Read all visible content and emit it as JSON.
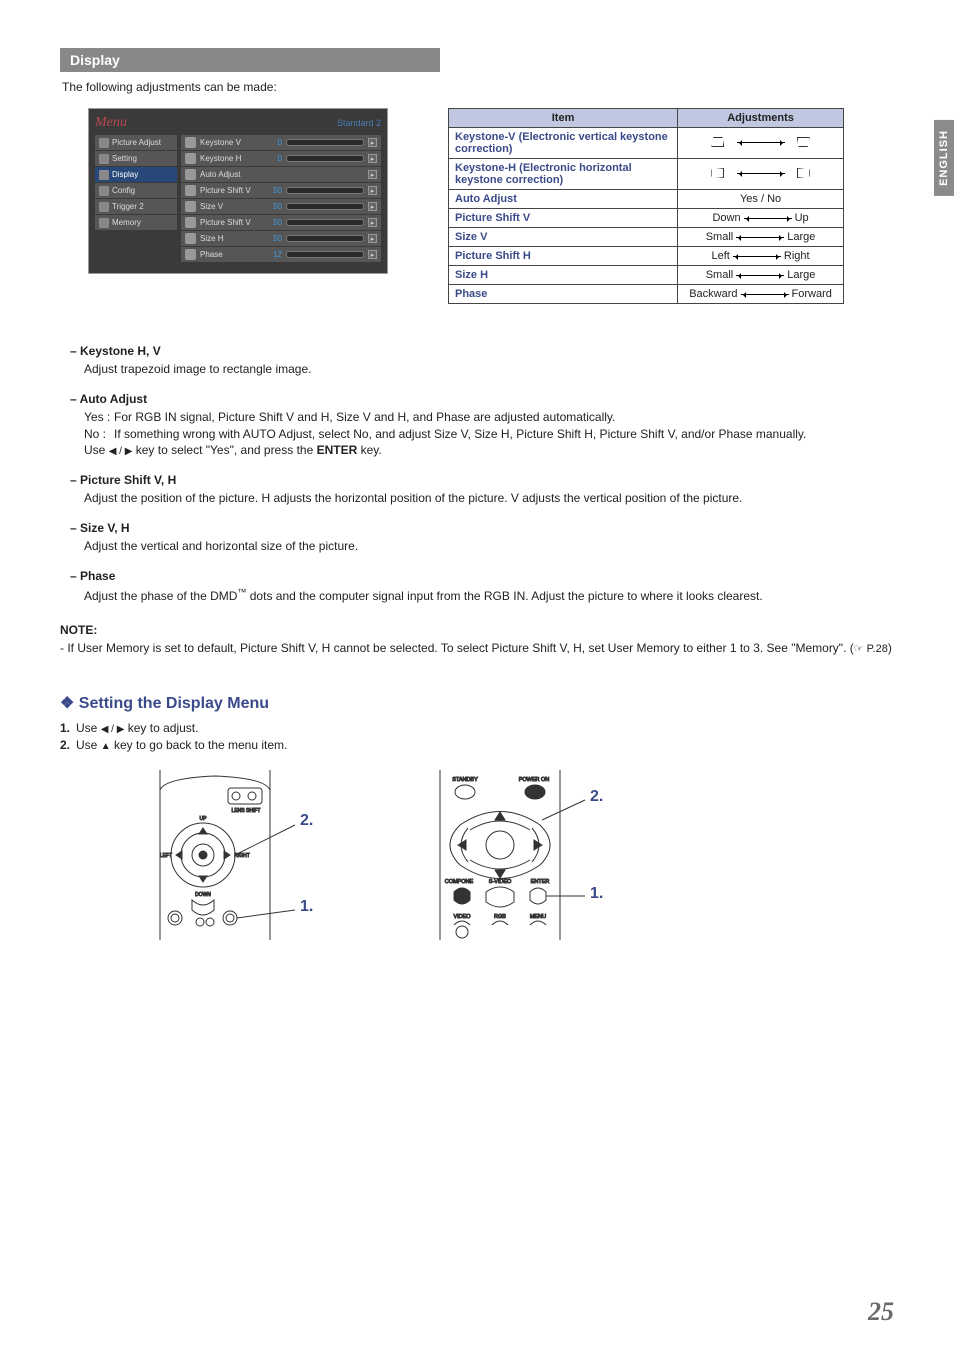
{
  "lang_tab": "ENGLISH",
  "section_header": "Display",
  "intro": "The following adjustments can be made:",
  "menu": {
    "title": "Menu",
    "standard": "Standard 2",
    "left_items": [
      {
        "label": "Picture Adjust",
        "selected": false
      },
      {
        "label": "Setting",
        "selected": false
      },
      {
        "label": "Display",
        "selected": true
      },
      {
        "label": "Config",
        "selected": false
      },
      {
        "label": "Trigger 2",
        "selected": false
      },
      {
        "label": "Memory",
        "selected": false
      }
    ],
    "right_items": [
      {
        "label": "Keystone V",
        "value": "0",
        "fill": 50,
        "btn": true
      },
      {
        "label": "Keystone H",
        "value": "0",
        "fill": 50,
        "btn": true
      },
      {
        "label": "Auto Adjust",
        "value": "",
        "fill": 0,
        "btn": true
      },
      {
        "label": "Picture Shift V",
        "value": "50",
        "fill": 50,
        "btn": true
      },
      {
        "label": "Size V",
        "value": "50",
        "fill": 50,
        "btn": true
      },
      {
        "label": "Picture Shift V",
        "value": "50",
        "fill": 50,
        "btn": true
      },
      {
        "label": "Size H",
        "value": "50",
        "fill": 50,
        "btn": true
      },
      {
        "label": "Phase",
        "value": "12",
        "fill": 22,
        "btn": true
      }
    ]
  },
  "adj_table": {
    "headers": [
      "Item",
      "Adjustments"
    ],
    "rows": [
      {
        "item": "Keystone-V (Electronic vertical keystone correction)",
        "adj_type": "trap-v"
      },
      {
        "item": "Keystone-H (Electronic horizontal keystone correction)",
        "adj_type": "trap-h"
      },
      {
        "item": "Auto Adjust",
        "adj_type": "text",
        "adj_text": "Yes / No"
      },
      {
        "item": "Picture Shift V",
        "adj_type": "arrow",
        "left": "Down",
        "right": "Up"
      },
      {
        "item": "Size V",
        "adj_type": "arrow",
        "left": "Small",
        "right": "Large"
      },
      {
        "item": "Picture Shift H",
        "adj_type": "arrow",
        "left": "Left",
        "right": "Right"
      },
      {
        "item": "Size H",
        "adj_type": "arrow",
        "left": "Small",
        "right": "Large"
      },
      {
        "item": "Phase",
        "adj_type": "arrow",
        "left": "Backward",
        "right": "Forward"
      }
    ]
  },
  "descriptions": {
    "keystone": {
      "title": "Keystone H, V",
      "body": "Adjust trapezoid image to rectangle image."
    },
    "auto_adjust": {
      "title": "Auto Adjust",
      "yes_label": "Yes :",
      "yes_body": "For RGB IN signal, Picture Shift V and H, Size V and H, and Phase are adjusted automatically.",
      "no_label": "No  :",
      "no_body": "If something wrong with AUTO Adjust, select No, and adjust Size V, Size H, Picture Shift H, Picture Shift V, and/or Phase manually.",
      "use_line_pre": "Use ",
      "use_line_mid": " key to select \"Yes\", and press the ",
      "enter": "ENTER",
      "use_line_post": " key."
    },
    "picture_shift": {
      "title": "Picture Shift V, H",
      "body": "Adjust the position of the picture. H adjusts the horizontal position of the picture. V adjusts the vertical position of the picture."
    },
    "size": {
      "title": "Size V, H",
      "body": "Adjust the vertical and horizontal size of the picture."
    },
    "phase": {
      "title": "Phase",
      "body_pre": "Adjust the phase of the DMD",
      "tm": "™",
      "body_post": " dots and the computer signal input from the RGB IN. Adjust the picture to where it looks clearest."
    }
  },
  "note": {
    "label": "NOTE:",
    "body_pre": "-  If User Memory is set to default, Picture Shift V, H cannot be selected. To select Picture Shift V, H, set User Memory to either 1 to 3. See \"Memory\". (",
    "ref": "☞ P.28",
    "body_post": ")"
  },
  "setting": {
    "heading": "Setting the Display Menu",
    "steps": [
      {
        "n": "1.",
        "pre": "Use ",
        "mid": " key to adjust."
      },
      {
        "n": "2.",
        "pre": "Use ",
        "mid": " key to go back to the menu item."
      }
    ],
    "callouts": {
      "one": "1.",
      "two": "2."
    },
    "remote_labels": {
      "standby": "STANDBY",
      "power_on": "POWER ON",
      "compone": "COMPONE",
      "svideo": "S-VIDEO",
      "enter": "ENTER",
      "video": "VIDEO",
      "rgb": "RGB",
      "menu": "MENU"
    },
    "proj_labels": {
      "up": "UP",
      "down": "DOWN",
      "left": "LEFT",
      "right": "RIGHT",
      "lens_shift": "LENS SHIFT"
    }
  },
  "page_number": "25"
}
